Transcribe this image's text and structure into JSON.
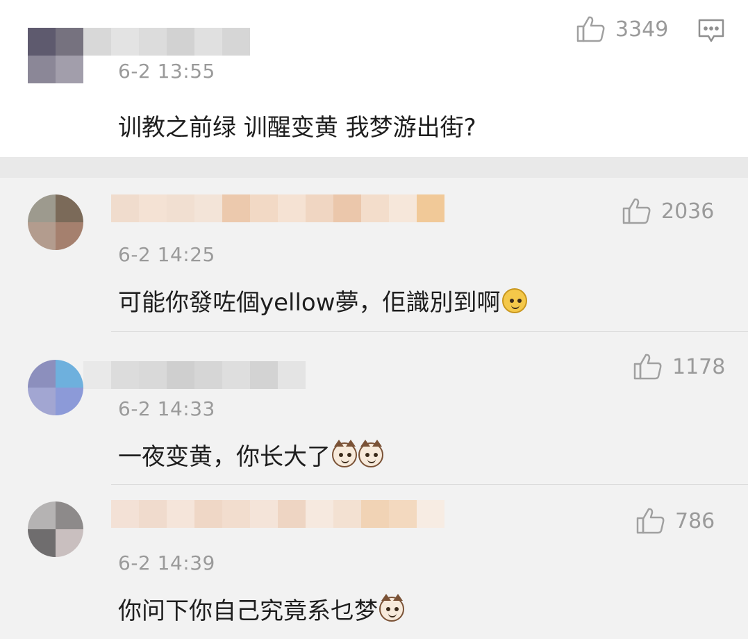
{
  "comments": [
    {
      "timestamp": "6-2 13:55",
      "text": "训教之前绿  训醒变黄  我梦游出街?",
      "likes": "3349",
      "emojis": []
    },
    {
      "timestamp": "6-2 14:25",
      "text": "可能你發咗個yellow夢，佢識別到啊",
      "likes": "2036",
      "emojis": [
        "doge-emoji"
      ]
    },
    {
      "timestamp": "6-2 14:33",
      "text": "一夜变黄，你长大了",
      "likes": "1178",
      "emojis": [
        "cat-emoji",
        "cat-emoji"
      ]
    },
    {
      "timestamp": "6-2 14:39",
      "text": "你问下你自己究竟系乜梦",
      "likes": "786",
      "emojis": [
        "cat-emoji"
      ]
    }
  ],
  "icons": {
    "like": "thumbs-up-icon",
    "reply": "comment-bubble-icon"
  },
  "colors": {
    "top_background": "#ffffff",
    "reply_background": "#f2f2f2",
    "meta_text": "#9a9a9a",
    "body_text": "#1e1e1e"
  }
}
